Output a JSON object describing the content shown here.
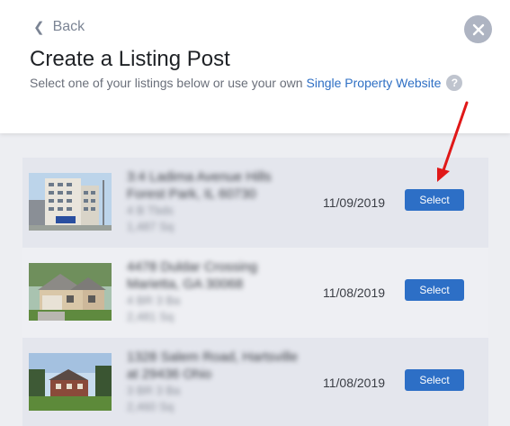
{
  "header": {
    "back_label": "Back",
    "title": "Create a Listing Post",
    "subtitle": "Select one of your listings below or use your own",
    "subtitle_link": "Single Property Website",
    "help_glyph": "?"
  },
  "colors": {
    "accent": "#2d6fc6",
    "annotation_arrow": "#e01818"
  },
  "listings": [
    {
      "address_line1": "3:4 Ladima Avenue Hills",
      "address_line2": "Forest Park, IL 60730",
      "meta_line1": "4 B Tbds",
      "meta_line2": "1,487 Sq",
      "date": "11/09/2019",
      "select_label": "Select"
    },
    {
      "address_line1": "4478 Duldar Crossing",
      "address_line2": "Marietta, GA 30068",
      "meta_line1": "4 BR 3 Ba",
      "meta_line2": "2,481 Sq",
      "date": "11/08/2019",
      "select_label": "Select"
    },
    {
      "address_line1": "1328 Salem Road, Hartsville",
      "address_line2": "at 29436 Ohio",
      "meta_line1": "3 BR 3 Ba",
      "meta_line2": "2,460 Sq",
      "date": "11/08/2019",
      "select_label": "Select"
    }
  ]
}
